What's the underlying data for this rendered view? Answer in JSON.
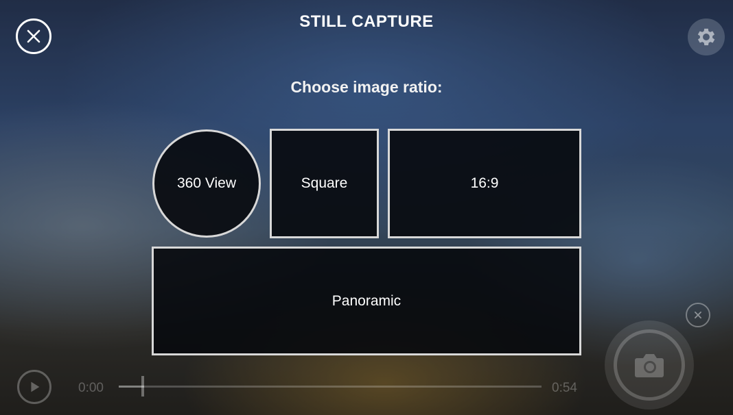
{
  "header": {
    "title": "STILL CAPTURE",
    "close_icon": "close-icon",
    "settings_icon": "gear-icon"
  },
  "prompt": "Choose image ratio:",
  "ratio_options": [
    {
      "label": "360 View",
      "shape": "circle"
    },
    {
      "label": "Square",
      "shape": "square"
    },
    {
      "label": "16:9",
      "shape": "rectangle"
    },
    {
      "label": "Panoramic",
      "shape": "wide-rectangle"
    }
  ],
  "playback": {
    "play_icon": "play-icon",
    "time_start": "0:00",
    "time_end": "0:54",
    "progress_fraction": 0.06
  },
  "camera": {
    "dismiss_icon": "close-icon",
    "shutter_icon": "camera-icon"
  },
  "colors": {
    "option_border": "#d8d8d8",
    "option_fill": "#08090e",
    "text": "#ffffff"
  }
}
